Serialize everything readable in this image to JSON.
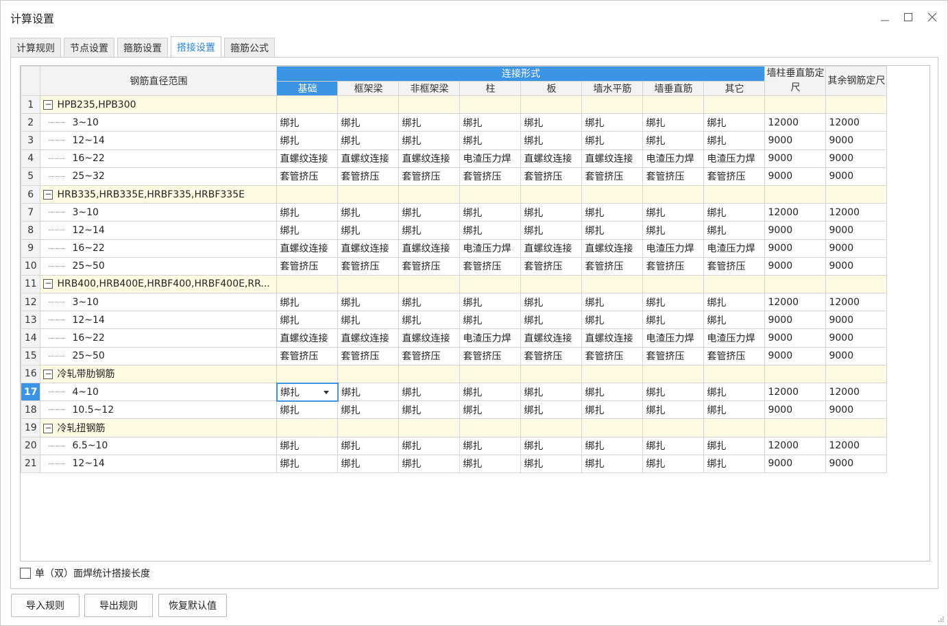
{
  "window": {
    "title": "计算设置",
    "minimize_icon": "minimize-icon",
    "maximize_icon": "maximize-icon",
    "close_icon": "close-icon"
  },
  "tabs": [
    {
      "label": "计算规则",
      "active": false
    },
    {
      "label": "节点设置",
      "active": false
    },
    {
      "label": "箍筋设置",
      "active": false
    },
    {
      "label": "搭接设置",
      "active": true
    },
    {
      "label": "箍筋公式",
      "active": false
    }
  ],
  "grid": {
    "header": {
      "range_label": "钢筋直径范围",
      "connection_group": "连接形式",
      "connection_cols": [
        "基础",
        "框架梁",
        "非框架梁",
        "柱",
        "板",
        "墙水平筋",
        "墙垂直筋",
        "其它"
      ],
      "wall_col_length": "墙柱垂直筋定尺",
      "other_length": "其余钢筋定尺"
    },
    "rows": [
      {
        "num": "1",
        "type": "group",
        "label": "HPB235,HPB300"
      },
      {
        "num": "2",
        "type": "item",
        "label": "3~10",
        "cells": [
          "绑扎",
          "绑扎",
          "绑扎",
          "绑扎",
          "绑扎",
          "绑扎",
          "绑扎",
          "绑扎",
          "12000",
          "12000"
        ]
      },
      {
        "num": "3",
        "type": "item",
        "label": "12~14",
        "cells": [
          "绑扎",
          "绑扎",
          "绑扎",
          "绑扎",
          "绑扎",
          "绑扎",
          "绑扎",
          "绑扎",
          "9000",
          "9000"
        ]
      },
      {
        "num": "4",
        "type": "item",
        "label": "16~22",
        "cells": [
          "直螺纹连接",
          "直螺纹连接",
          "直螺纹连接",
          "电渣压力焊",
          "直螺纹连接",
          "直螺纹连接",
          "电渣压力焊",
          "电渣压力焊",
          "9000",
          "9000"
        ]
      },
      {
        "num": "5",
        "type": "item",
        "label": "25~32",
        "cells": [
          "套管挤压",
          "套管挤压",
          "套管挤压",
          "套管挤压",
          "套管挤压",
          "套管挤压",
          "套管挤压",
          "套管挤压",
          "9000",
          "9000"
        ]
      },
      {
        "num": "6",
        "type": "group",
        "label": "HRB335,HRB335E,HRBF335,HRBF335E"
      },
      {
        "num": "7",
        "type": "item",
        "label": "3~10",
        "cells": [
          "绑扎",
          "绑扎",
          "绑扎",
          "绑扎",
          "绑扎",
          "绑扎",
          "绑扎",
          "绑扎",
          "12000",
          "12000"
        ]
      },
      {
        "num": "8",
        "type": "item",
        "label": "12~14",
        "cells": [
          "绑扎",
          "绑扎",
          "绑扎",
          "绑扎",
          "绑扎",
          "绑扎",
          "绑扎",
          "绑扎",
          "9000",
          "9000"
        ]
      },
      {
        "num": "9",
        "type": "item",
        "label": "16~22",
        "cells": [
          "直螺纹连接",
          "直螺纹连接",
          "直螺纹连接",
          "电渣压力焊",
          "直螺纹连接",
          "直螺纹连接",
          "电渣压力焊",
          "电渣压力焊",
          "9000",
          "9000"
        ]
      },
      {
        "num": "10",
        "type": "item",
        "label": "25~50",
        "cells": [
          "套管挤压",
          "套管挤压",
          "套管挤压",
          "套管挤压",
          "套管挤压",
          "套管挤压",
          "套管挤压",
          "套管挤压",
          "9000",
          "9000"
        ]
      },
      {
        "num": "11",
        "type": "group",
        "label": "HRB400,HRB400E,HRBF400,HRBF400E,RR..."
      },
      {
        "num": "12",
        "type": "item",
        "label": "3~10",
        "cells": [
          "绑扎",
          "绑扎",
          "绑扎",
          "绑扎",
          "绑扎",
          "绑扎",
          "绑扎",
          "绑扎",
          "12000",
          "12000"
        ]
      },
      {
        "num": "13",
        "type": "item",
        "label": "12~14",
        "cells": [
          "绑扎",
          "绑扎",
          "绑扎",
          "绑扎",
          "绑扎",
          "绑扎",
          "绑扎",
          "绑扎",
          "9000",
          "9000"
        ]
      },
      {
        "num": "14",
        "type": "item",
        "label": "16~22",
        "cells": [
          "直螺纹连接",
          "直螺纹连接",
          "直螺纹连接",
          "电渣压力焊",
          "直螺纹连接",
          "直螺纹连接",
          "电渣压力焊",
          "电渣压力焊",
          "9000",
          "9000"
        ]
      },
      {
        "num": "15",
        "type": "item",
        "label": "25~50",
        "cells": [
          "套管挤压",
          "套管挤压",
          "套管挤压",
          "套管挤压",
          "套管挤压",
          "套管挤压",
          "套管挤压",
          "套管挤压",
          "9000",
          "9000"
        ]
      },
      {
        "num": "16",
        "type": "group",
        "label": "冷轧带肋钢筋"
      },
      {
        "num": "17",
        "type": "item",
        "label": "4~10",
        "selected": true,
        "cells": [
          "绑扎",
          "绑扎",
          "绑扎",
          "绑扎",
          "绑扎",
          "绑扎",
          "绑扎",
          "绑扎",
          "12000",
          "12000"
        ]
      },
      {
        "num": "18",
        "type": "item",
        "label": "10.5~12",
        "cells": [
          "绑扎",
          "绑扎",
          "绑扎",
          "绑扎",
          "绑扎",
          "绑扎",
          "绑扎",
          "绑扎",
          "9000",
          "9000"
        ]
      },
      {
        "num": "19",
        "type": "group",
        "label": "冷轧扭钢筋"
      },
      {
        "num": "20",
        "type": "item",
        "label": "6.5~10",
        "cells": [
          "绑扎",
          "绑扎",
          "绑扎",
          "绑扎",
          "绑扎",
          "绑扎",
          "绑扎",
          "绑扎",
          "12000",
          "12000"
        ]
      },
      {
        "num": "21",
        "type": "item",
        "label": "12~14",
        "cells": [
          "绑扎",
          "绑扎",
          "绑扎",
          "绑扎",
          "绑扎",
          "绑扎",
          "绑扎",
          "绑扎",
          "9000",
          "9000"
        ]
      }
    ]
  },
  "options": {
    "weld_checkbox_label": "单（双）面焊统计搭接长度",
    "weld_checked": false
  },
  "buttons": {
    "import": "导入规则",
    "export": "导出规则",
    "restore": "恢复默认值"
  },
  "colors": {
    "accent": "#3b95e4",
    "group_row_bg": "#fffbe2",
    "active_tab_text": "#2a84d8"
  }
}
